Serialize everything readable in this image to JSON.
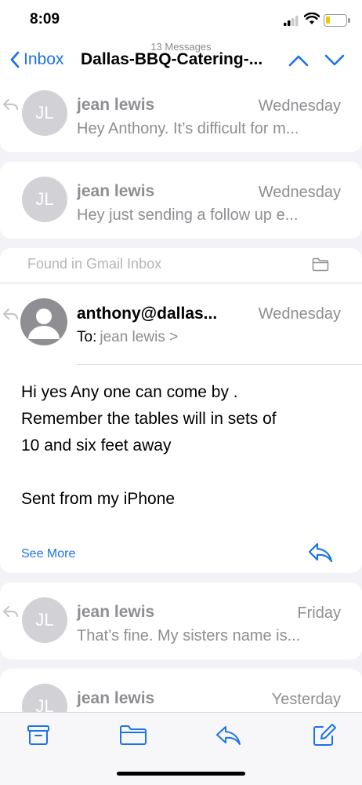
{
  "status": {
    "time": "8:09"
  },
  "nav": {
    "message_count": "13 Messages",
    "back_label": "Inbox",
    "title": "Dallas-BBQ-Catering-..."
  },
  "messages": [
    {
      "initials": "JL",
      "sender": "jean lewis",
      "date": "Wednesday",
      "preview": "Hey Anthony. It’s difficult for m..."
    },
    {
      "initials": "JL",
      "sender": "jean lewis",
      "date": "Wednesday",
      "preview": "Hey just sending a follow up e..."
    },
    {
      "initials": "JL",
      "sender": "jean lewis",
      "date": "Friday",
      "preview": "That’s fine. My sisters name is..."
    },
    {
      "initials": "JL",
      "sender": "jean lewis",
      "date": "Yesterday",
      "preview": ""
    }
  ],
  "open_message": {
    "found_in": "Found in Gmail Inbox",
    "sender": "anthony@dallas...",
    "date": "Wednesday",
    "to_label": "To:",
    "to_value": "jean lewis >",
    "body": [
      "Hi yes Any one can come by .",
      "Remember the tables will in sets of",
      "10 and six feet away",
      "",
      "Sent from my iPhone"
    ],
    "see_more": "See More"
  },
  "colors": {
    "accent": "#1a73e8",
    "secondary_text": "#8e8e93",
    "background": "#f2f2f7"
  },
  "icons": {
    "toolbar": [
      "archive-icon",
      "folder-icon",
      "reply-icon",
      "compose-icon"
    ]
  }
}
